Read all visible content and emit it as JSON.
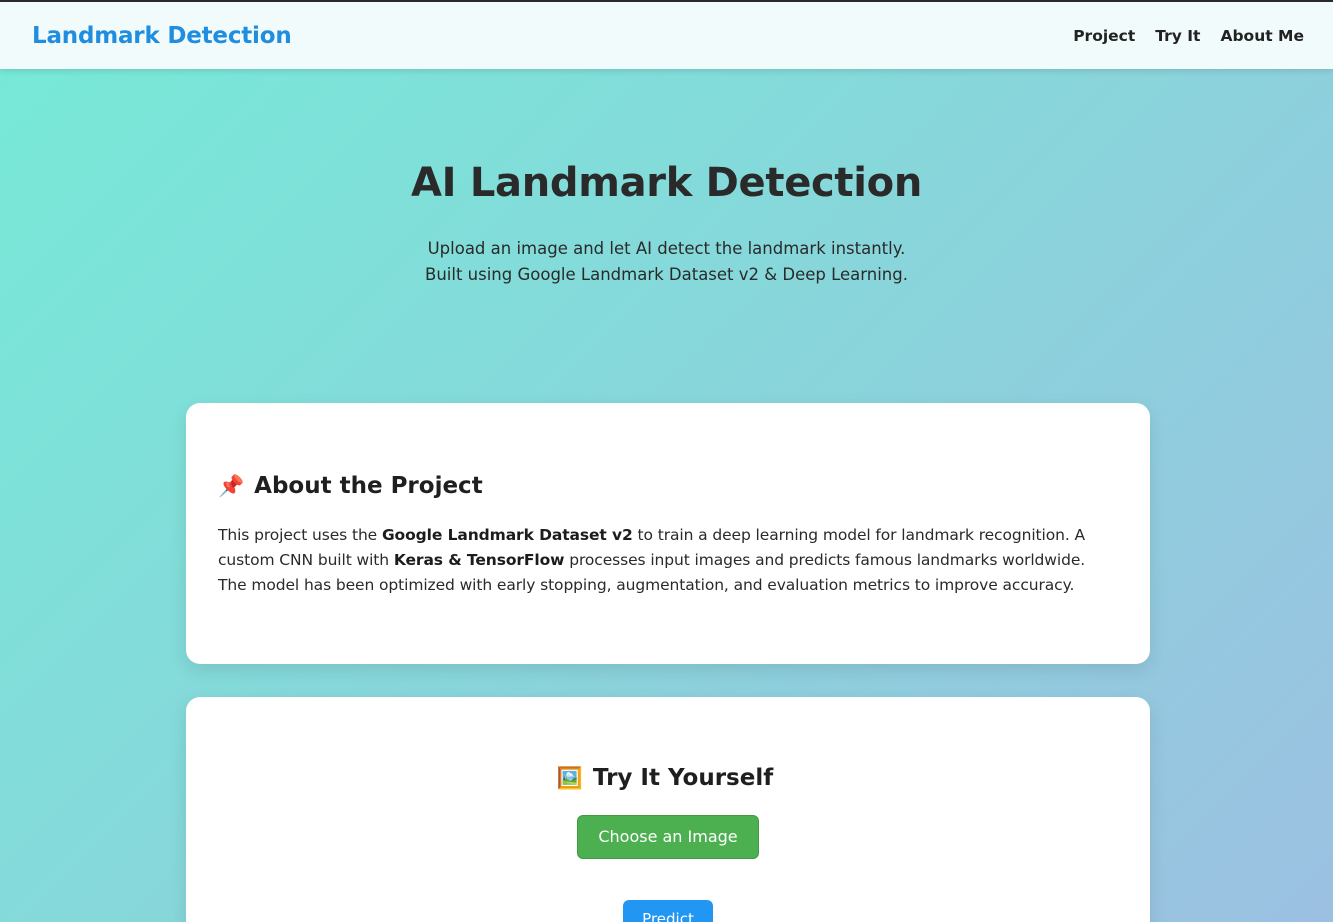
{
  "navbar": {
    "brand": "Landmark Detection",
    "links": [
      "Project",
      "Try It",
      "About Me"
    ]
  },
  "hero": {
    "title": "AI Landmark Detection",
    "subtitle_line1": "Upload an image and let AI detect the landmark instantly.",
    "subtitle_line2": "Built using Google Landmark Dataset v2 & Deep Learning."
  },
  "about": {
    "icon": "pushpin-icon",
    "icon_glyph": "📌",
    "heading": "About the Project",
    "p1": "This project uses the ",
    "b1": "Google Landmark Dataset v2",
    "p2": " to train a deep learning model for landmark recognition. A custom CNN built with ",
    "b2": "Keras & TensorFlow",
    "p3": " processes input images and predicts famous landmarks worldwide. The model has been optimized with early stopping, augmentation, and evaluation metrics to improve accuracy."
  },
  "try": {
    "icon": "framed-picture-icon",
    "icon_glyph": "🖼️",
    "heading": "Try It Yourself",
    "choose_label": "Choose an Image",
    "predict_label": "Predict"
  },
  "colors": {
    "brand": "#1f8de0",
    "choose_button": "#4caf50",
    "predict_button": "#2196f3"
  }
}
